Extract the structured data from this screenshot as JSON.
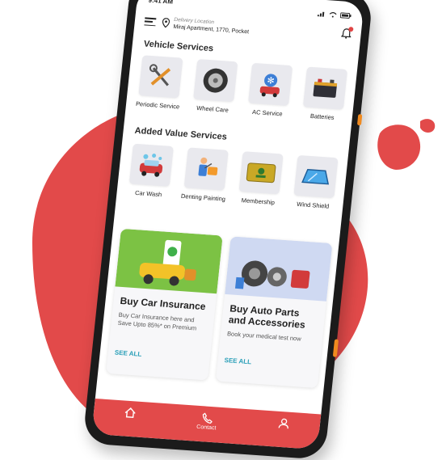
{
  "status_bar": {
    "time": "9:41 AM"
  },
  "header": {
    "location_caption": "Delivery Location",
    "location_address": "Miraj Apartment, 1770, Pocket"
  },
  "vehicle_services": {
    "title": "Vehicle Services",
    "items": [
      {
        "label": "Periodic Service",
        "icon": "wrench-screwdriver-icon"
      },
      {
        "label": "Wheel Care",
        "icon": "tire-icon"
      },
      {
        "label": "AC Service",
        "icon": "car-ac-icon"
      },
      {
        "label": "Batteries",
        "icon": "battery-icon"
      }
    ]
  },
  "added_value_services": {
    "title": "Added Value Services",
    "items": [
      {
        "label": "Car Wash",
        "icon": "car-wash-icon"
      },
      {
        "label": "Denting Painting",
        "icon": "painting-icon"
      },
      {
        "label": "Membership",
        "icon": "membership-card-icon"
      },
      {
        "label": "Wind Shield",
        "icon": "windshield-icon"
      }
    ]
  },
  "promo_cards": [
    {
      "title": "Buy Car Insurance",
      "description": "Buy Car Insurance here and Save Upto 85%* on Premium",
      "link": "SEE ALL",
      "icon": "car-insurance-illustration"
    },
    {
      "title": "Buy Auto Parts and Accessories",
      "description": "Book your medical test now",
      "link": "SEE ALL",
      "icon": "auto-parts-illustration"
    }
  ],
  "bottom_nav": {
    "items": [
      {
        "label": "",
        "icon": "home-icon"
      },
      {
        "label": "Contact",
        "icon": "phone-icon"
      },
      {
        "label": "",
        "icon": "user-icon"
      }
    ]
  },
  "colors": {
    "accent": "#e24a4a",
    "link": "#2a9fb8",
    "side_buttons": "#f08a1f"
  }
}
